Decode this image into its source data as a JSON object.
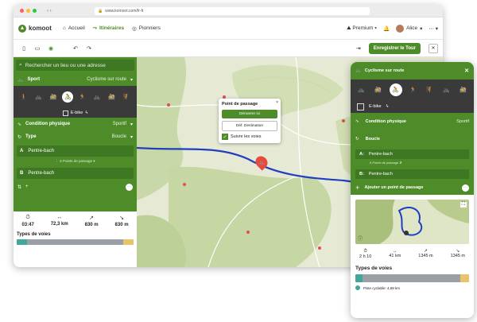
{
  "browser": {
    "url": "www.komoot.com/fr-fr"
  },
  "nav": {
    "logo": "komoot",
    "home": "Accueil",
    "routes": "Itinéraires",
    "pioneers": "Pionniers",
    "premium": "Premium",
    "user": "Alice"
  },
  "toolbar": {
    "save": "Enregistrer le Tour"
  },
  "sidebar": {
    "search_placeholder": "Rechercher un lieu ou une adresse",
    "sport_label": "Sport",
    "sport_value": "Cyclisme sur route",
    "ebike": "E-bike",
    "fitness_label": "Condition physique",
    "fitness_value": "Sportif",
    "type_label": "Type",
    "type_value": "Boucle",
    "wp_a_letter": "A",
    "wp_a": "Pentre-bach",
    "wp_mid": "6 Points de passage",
    "wp_b_letter": "B",
    "wp_b": "Pentre-bach",
    "stats": [
      {
        "icon": "⏱",
        "value": "03:47"
      },
      {
        "icon": "↔",
        "value": "72,3 km"
      },
      {
        "icon": "↗",
        "value": "830 m"
      },
      {
        "icon": "↘",
        "value": "830 m"
      }
    ],
    "types_label": "Types de voies"
  },
  "popup": {
    "title": "Point de passage",
    "start": "Démarrer ici",
    "dest": "Déf. Destination",
    "follow": "Suivre les voies",
    "close": "×"
  },
  "phone": {
    "title": "Cyclisme sur route",
    "ebike": "E-bike",
    "fitness_label": "Condition physique",
    "fitness_value": "Sportif",
    "type_label": "Boucle",
    "wp_a_letter": "A:",
    "wp_a": "Pentre-bach",
    "wp_mid": "6 Points de passage",
    "wp_b_letter": "B:",
    "wp_b": "Pentre-bach",
    "add_wp": "Ajouter un point de passage",
    "stats": [
      {
        "icon": "⏱",
        "value": "2 h 10"
      },
      {
        "icon": "↔",
        "value": "41 km"
      },
      {
        "icon": "↗",
        "value": "1345 m"
      },
      {
        "icon": "↘",
        "value": "1345 m"
      }
    ],
    "types_label": "Types de voies",
    "legend": "Piste cyclable: 4,69 km"
  },
  "colors": {
    "brand": "#4e8c2a",
    "route": "#1f3fbf",
    "dark": "#3a3a3a"
  }
}
